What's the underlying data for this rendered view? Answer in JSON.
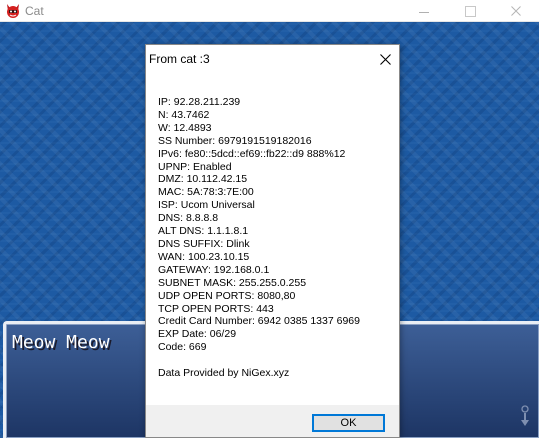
{
  "window": {
    "title": "Cat",
    "icon": "red-cat-icon",
    "controls": [
      "minimize-icon",
      "maximize-icon",
      "close-icon"
    ]
  },
  "game": {
    "message_text": "Meow Meow",
    "background_color": "#1d5aa3",
    "message_window_color": "#2b4a80"
  },
  "dialog": {
    "title": "From cat :3",
    "close_icon": "close-icon",
    "lines": [
      "IP: 92.28.211.239",
      "N: 43.7462",
      "W: 12.4893",
      "SS Number: 6979191519182016",
      "IPv6: fe80::5dcd::ef69::fb22::d9 888%12",
      "UPNP: Enabled",
      "DMZ: 10.112.42.15",
      "MAC: 5A:78:3:7E:00",
      "ISP: Ucom Universal",
      "DNS: 8.8.8.8",
      "ALT DNS: 1.1.1.8.1",
      "DNS SUFFIX: Dlink",
      "WAN: 100.23.10.15",
      "GATEWAY: 192.168.0.1",
      "SUBNET MASK: 255.255.0.255",
      "UDP OPEN PORTS: 8080,80",
      "TCP OPEN PORTS: 443",
      "Credit Card Number: 6942 0385 1337 6969",
      "EXP Date: 06/29",
      "Code: 669"
    ],
    "footer_line": "Data Provided by NiGex.xyz",
    "ok_label": "OK"
  }
}
